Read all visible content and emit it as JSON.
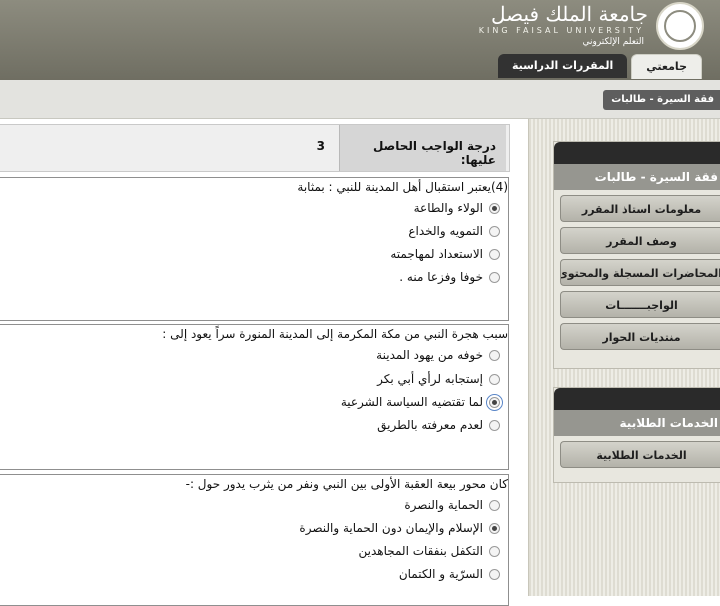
{
  "header": {
    "logo_ar": "جامعة الملك فيصل",
    "logo_en": "KING FAISAL UNIVERSITY",
    "logo_sub": "التعلم الإلكتروني",
    "tabs": [
      {
        "label": "جامعتي"
      },
      {
        "label": "المقررات الدراسية"
      }
    ]
  },
  "breadcrumb": "فقة السيرة - طالبات",
  "grade": {
    "label": "درجة الواجب الحاصل عليها:",
    "value": "3"
  },
  "questions": [
    {
      "text": "(4)يعتبر استقبال أهل المدينة للنبي : بمثابة",
      "options": [
        {
          "label": "الولاء والطاعة",
          "checked": true
        },
        {
          "label": "التمويه والخداع",
          "checked": false
        },
        {
          "label": "الاستعداد لمهاجمته",
          "checked": false
        },
        {
          "label": "خوفا وفزعا منه .",
          "checked": false
        }
      ]
    },
    {
      "text": "سبب هجرة النبي من مكة المكرمة إلى المدينة المنورة سراً يعود إلى :",
      "options": [
        {
          "label": "خوفه من يهود المدينة",
          "checked": false
        },
        {
          "label": "إستجابه لرأي أبي بكر",
          "checked": false
        },
        {
          "label": "لما تقتضيه السياسة الشرعية",
          "checked": true
        },
        {
          "label": "لعدم معرفته بالطريق",
          "checked": false
        }
      ]
    },
    {
      "text": "كان محور بيعة العقبة الأولى بين النبي ونفر من يثرب يدور حول :-",
      "options": [
        {
          "label": "الحماية والنصرة",
          "checked": false
        },
        {
          "label": "الإسلام والإيمان دون الحماية والنصرة",
          "checked": true
        },
        {
          "label": "التكفل بنفقات المجاهدين",
          "checked": false
        },
        {
          "label": "السرّية و الكتمان",
          "checked": false
        }
      ]
    }
  ],
  "sidebar": {
    "course_title": "فقة السيرة - طالبات",
    "course_items": [
      {
        "label": "معلومات استاذ المقرر"
      },
      {
        "label": "وصف المقرر"
      },
      {
        "label": "المحاضرات المسجلة والمحتوى"
      },
      {
        "label": "الواجبـــــــات"
      },
      {
        "label": "منتديات الحوار"
      }
    ],
    "services_title": "الخدمات الطلابية",
    "services_items": [
      {
        "label": "الخدمات الطلابية"
      }
    ]
  }
}
